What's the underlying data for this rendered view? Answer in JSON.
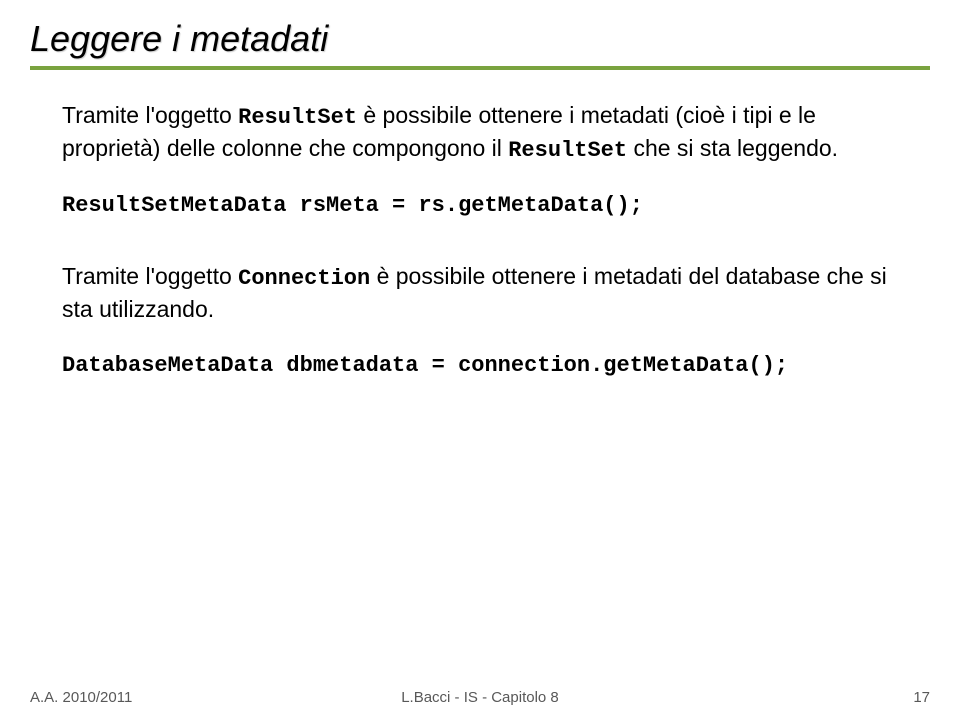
{
  "title": "Leggere i metadati",
  "para1_pre": "Tramite l",
  "apos": "'",
  "para1_mid1": "oggetto ",
  "code_rs": "ResultSet",
  "para1_mid2": " è possibile ottenere i metadati (cioè i tipi e le proprietà) delle colonne che compongono il ",
  "para1_mid3": " che si sta leggendo.",
  "code_line1": "ResultSetMetaData rsMeta = rs.getMetaData();",
  "para2_pre": "Tramite l",
  "para2_mid1": "oggetto ",
  "code_conn": "Connection",
  "para2_mid2": " è possibile ottenere i metadati del database che si sta utilizzando.",
  "code_line2": "DatabaseMetaData dbmetadata = connection.getMetaData();",
  "footer": {
    "left": "A.A. 2010/2011",
    "center": "L.Bacci - IS - Capitolo 8",
    "right": "17"
  }
}
